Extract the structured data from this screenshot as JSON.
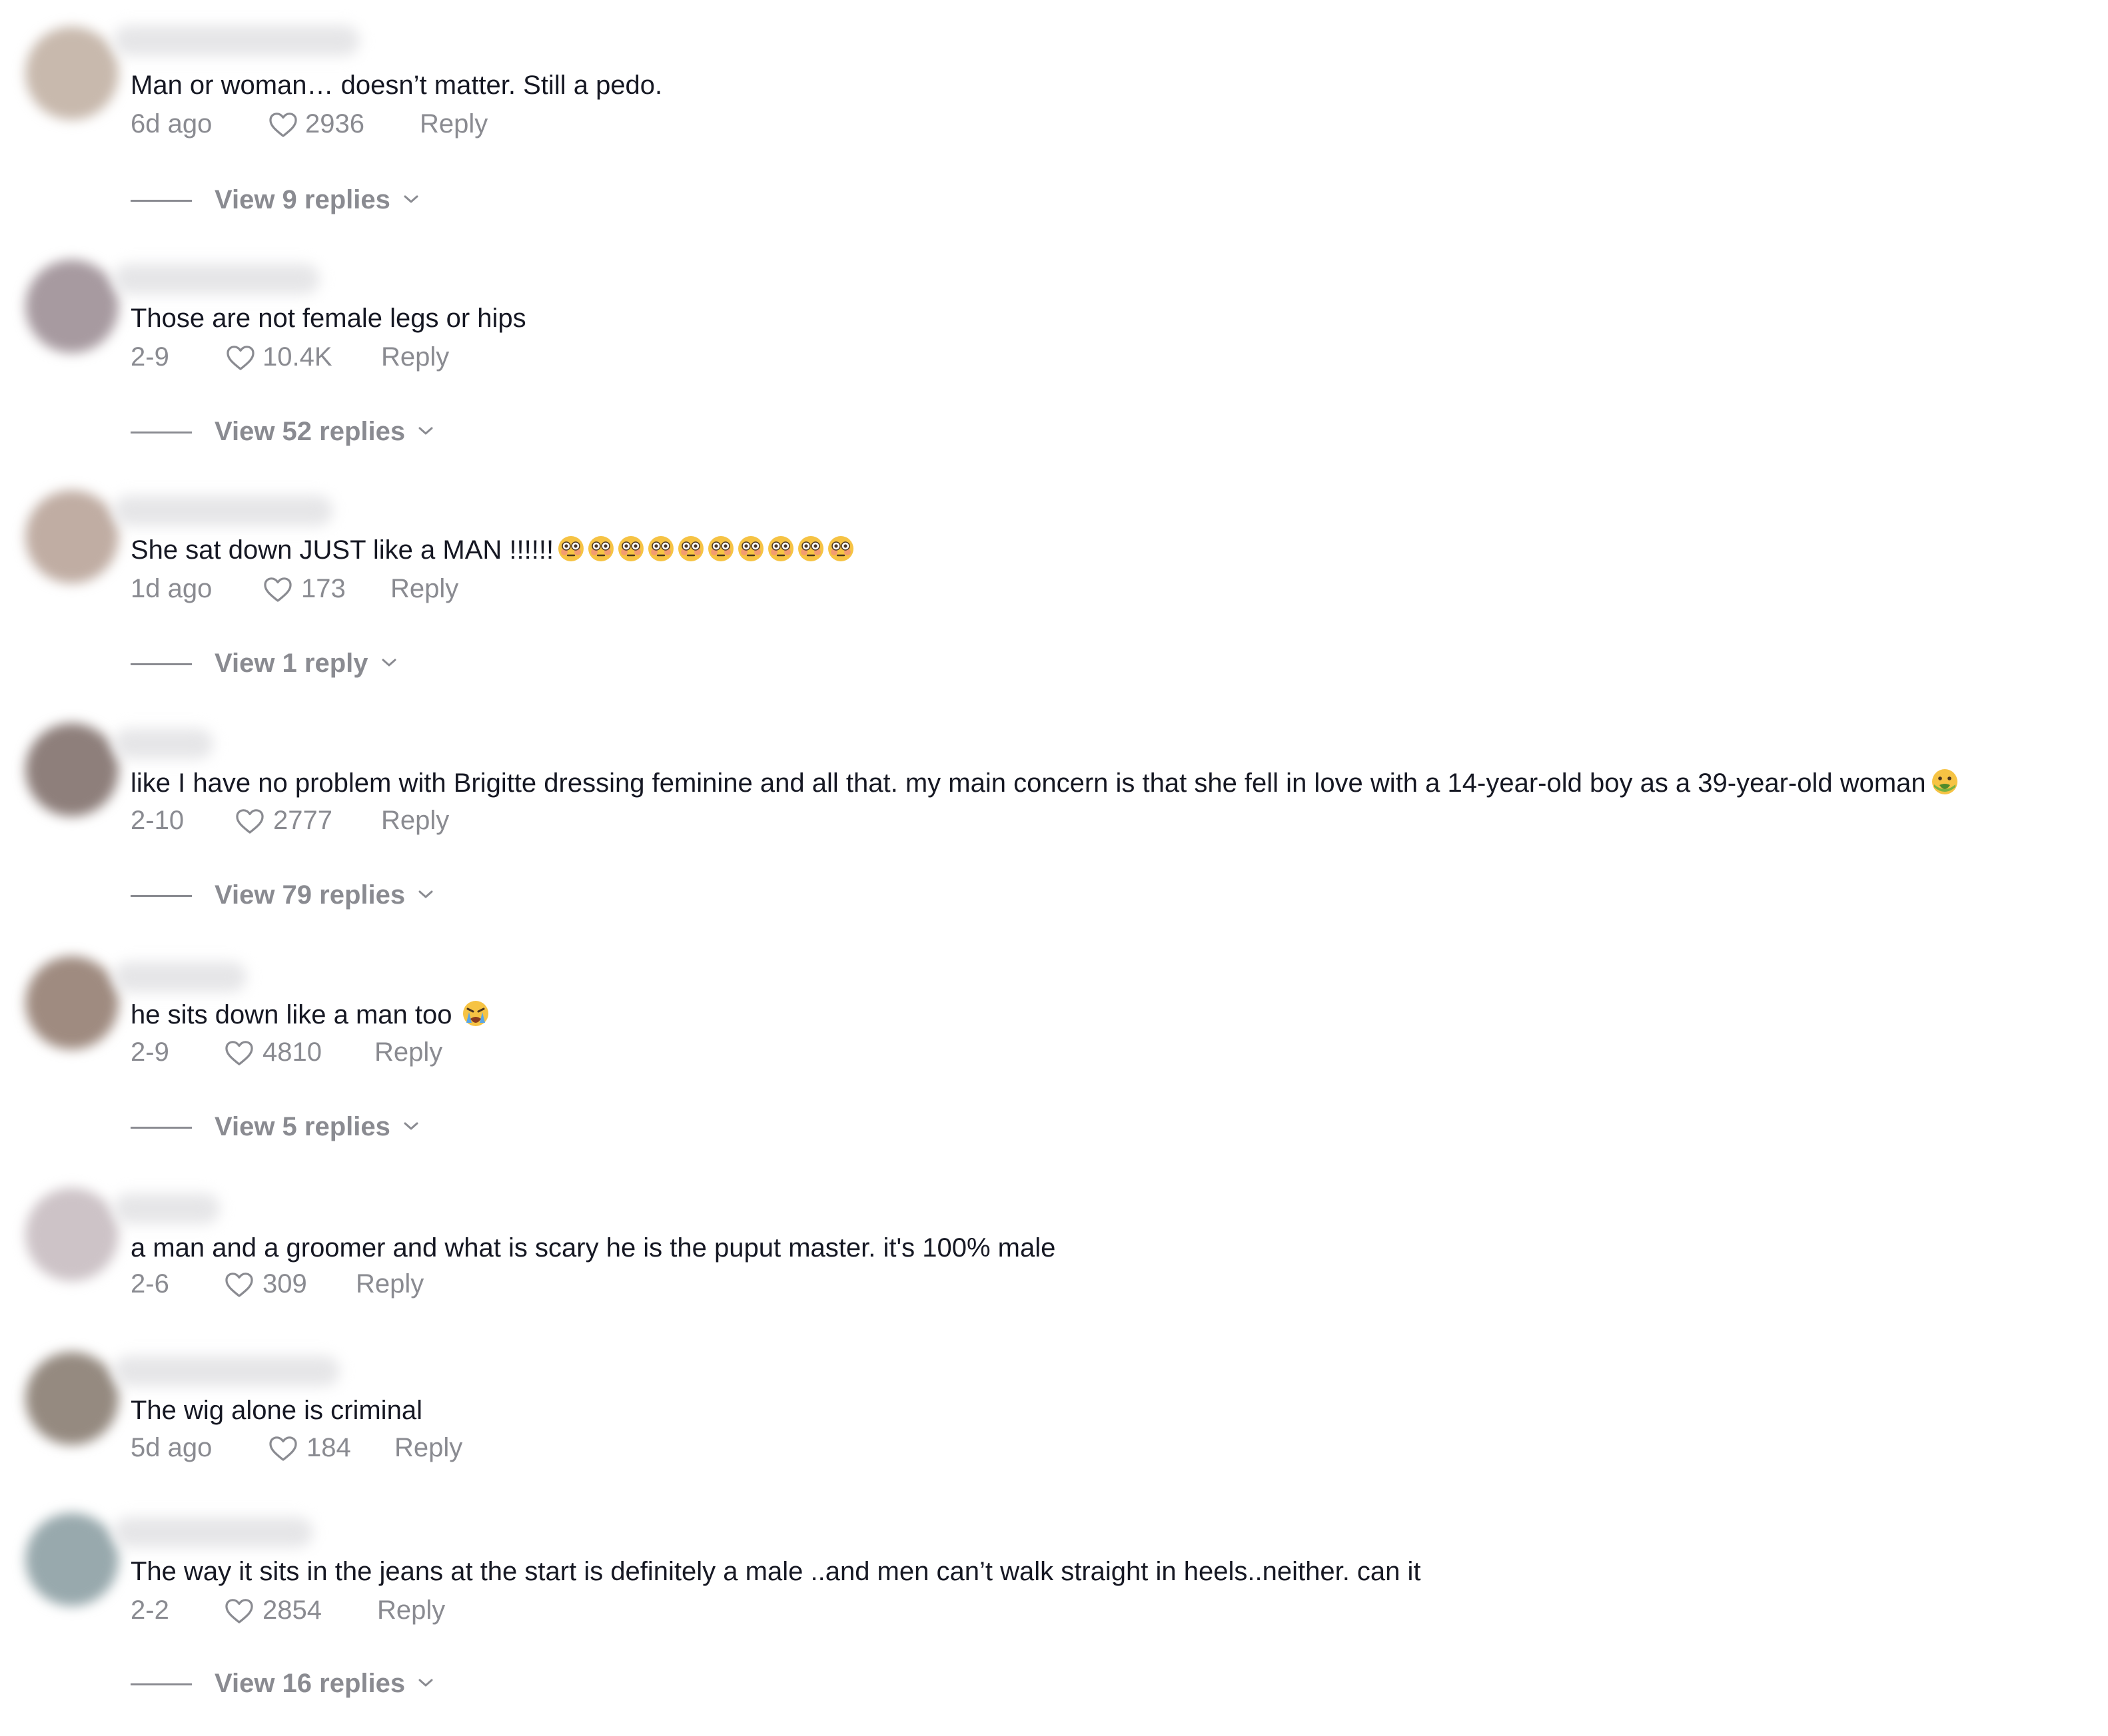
{
  "colors": {
    "text": "#161823",
    "secondary": "#8a8b91",
    "background": "#ffffff"
  },
  "comments": [
    {
      "text": "Man or woman… doesn’t matter. Still a pedo.",
      "date": "6d ago",
      "likes": "2936",
      "reply_label": "Reply",
      "replies_label": "View 9 replies",
      "avatar_color": "#c8b9ad"
    },
    {
      "text": "Those are not female legs or hips",
      "date": "2-9",
      "likes": "10.4K",
      "reply_label": "Reply",
      "replies_label": "View 52 replies",
      "avatar_color": "#a79aa0"
    },
    {
      "text": "She sat down JUST like a MAN !!!!!!",
      "date": "1d ago",
      "likes": "173",
      "reply_label": "Reply",
      "replies_label": "View 1 reply",
      "emoji_count": 10,
      "emoji_name": "flushed-face-emoji",
      "avatar_color": "#c0ada3"
    },
    {
      "text": "like I have no problem with Brigitte dressing feminine and all that. my main concern is that she fell in love with a 14-year-old boy as a 39-year-old woman",
      "date": "2-10",
      "likes": "2777",
      "reply_label": "Reply",
      "replies_label": "View 79 replies",
      "emoji_count": 1,
      "emoji_name": "nauseated-face-emoji",
      "avatar_color": "#8e7f7b"
    },
    {
      "text": "he sits down like a man too",
      "date": "2-9",
      "likes": "4810",
      "reply_label": "Reply",
      "replies_label": "View 5 replies",
      "emoji_count": 1,
      "emoji_name": "crying-face-emoji",
      "avatar_color": "#9f8b80"
    },
    {
      "text": "a man and a groomer and what is scary he is the puput master. it's 100% male",
      "date": "2-6",
      "likes": "309",
      "reply_label": "Reply",
      "avatar_color": "#cdc3c7"
    },
    {
      "text": "The wig alone is criminal",
      "date": "5d ago",
      "likes": "184",
      "reply_label": "Reply",
      "avatar_color": "#958a80"
    },
    {
      "text": "The way it sits in the jeans at the start is definitely a male ..and men can’t walk straight in heels..neither. can it",
      "date": "2-2",
      "likes": "2854",
      "reply_label": "Reply",
      "replies_label": "View 16 replies",
      "avatar_color": "#98a9ad"
    }
  ]
}
